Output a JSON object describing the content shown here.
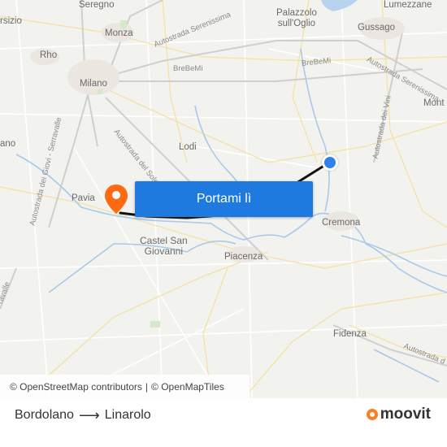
{
  "map": {
    "places": [
      {
        "id": "seregno",
        "label": "Seregno"
      },
      {
        "id": "palazzolo",
        "label": "Palazzolo\nsull'Oglio"
      },
      {
        "id": "lumezzane",
        "label": "Lumezzane"
      },
      {
        "id": "gussago",
        "label": "Gussago"
      },
      {
        "id": "monza",
        "label": "Monza"
      },
      {
        "id": "rho",
        "label": "Rho"
      },
      {
        "id": "milano",
        "label": "Milano"
      },
      {
        "id": "lodi",
        "label": "Lodi"
      },
      {
        "id": "pavia",
        "label": "Pavia"
      },
      {
        "id": "cremona",
        "label": "Cremona"
      },
      {
        "id": "castel",
        "label": "Castel San\nGiovanni"
      },
      {
        "id": "piacenza",
        "label": "Piacenza"
      },
      {
        "id": "fidenza",
        "label": "Fidenza"
      },
      {
        "id": "mont",
        "label": "Mont"
      },
      {
        "id": "arsizio",
        "label": "rsizio"
      },
      {
        "id": "ano",
        "label": "ano"
      }
    ],
    "roads": [
      {
        "id": "serenissima1",
        "label": "Autostrada Serenissima"
      },
      {
        "id": "brebemi1",
        "label": "BreBeMi"
      },
      {
        "id": "brebemi2",
        "label": "BreBeMi"
      },
      {
        "id": "serenissima2",
        "label": "Autostrada Serenissima"
      },
      {
        "id": "vini",
        "label": "Autostrada dei Vini"
      },
      {
        "id": "sole",
        "label": "Autostrada del Sole"
      },
      {
        "id": "giovi",
        "label": "Autostrada dei Giovi - Serravalle"
      },
      {
        "id": "serravalle2",
        "label": "ravalle"
      },
      {
        "id": "autostrada_se",
        "label": "Autostrada d"
      }
    ],
    "origin_marker": "blue-location-dot",
    "destination_marker": "orange-pin-icon",
    "colors": {
      "route": "#111111",
      "button": "#1f7ae0",
      "origin": "#2f80ed",
      "destination": "#ff6a13",
      "brand": "#ff7d1f"
    }
  },
  "go_button": {
    "label": "Portami lì"
  },
  "attribution": {
    "osm": "© OpenStreetMap contributors",
    "omt": "© OpenMapTiles",
    "separator": "|"
  },
  "footer": {
    "origin": "Bordolano",
    "arrow": "⟶",
    "destination": "Linarolo",
    "brand": "moovit"
  }
}
